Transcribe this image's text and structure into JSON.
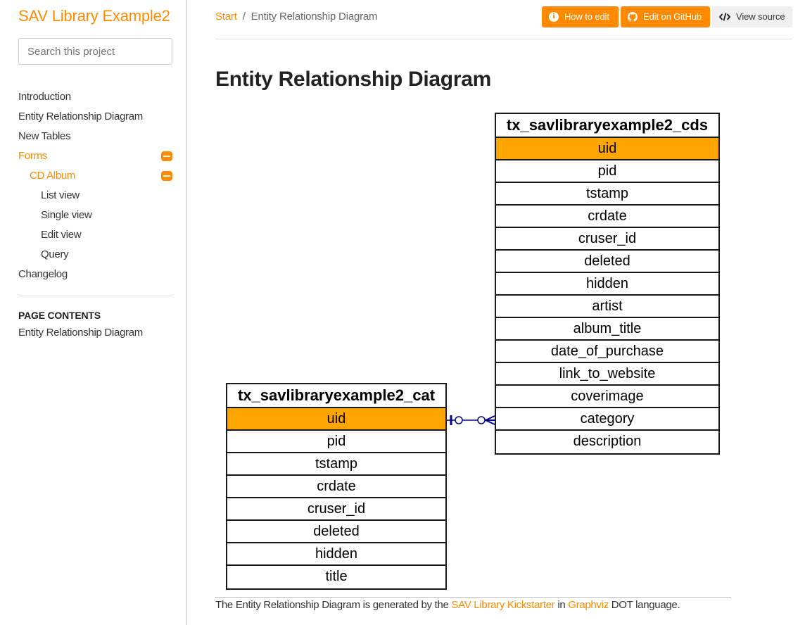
{
  "sidebar": {
    "site_title": "SAV Library Example2",
    "search_placeholder": "Search this project",
    "nav": [
      {
        "label": "Introduction",
        "level": 0,
        "active": false
      },
      {
        "label": "Entity Relationship Diagram",
        "level": 0,
        "active": false
      },
      {
        "label": "New Tables",
        "level": 0,
        "active": false
      },
      {
        "label": "Forms",
        "level": 0,
        "active": true,
        "expanded": true
      },
      {
        "label": "CD Album",
        "level": 1,
        "active": true,
        "expanded": true
      },
      {
        "label": "List view",
        "level": 2,
        "active": false
      },
      {
        "label": "Single view",
        "level": 2,
        "active": false
      },
      {
        "label": "Edit view",
        "level": 2,
        "active": false
      },
      {
        "label": "Query",
        "level": 2,
        "active": false
      },
      {
        "label": "Changelog",
        "level": 0,
        "active": false
      }
    ],
    "toc_title": "PAGE CONTENTS",
    "toc_items": [
      "Entity Relationship Diagram"
    ]
  },
  "breadcrumb": {
    "home": "Start",
    "separator": "/",
    "current": "Entity Relationship Diagram"
  },
  "toolbar": {
    "how_to_edit": "How to edit",
    "edit_on_github": "Edit on GitHub",
    "view_source": "View source"
  },
  "page": {
    "title": "Entity Relationship Diagram"
  },
  "diagram": {
    "entities": [
      {
        "name": "tx_savlibraryexample2_cds",
        "key_field": "uid",
        "fields": [
          "uid",
          "pid",
          "tstamp",
          "crdate",
          "cruser_id",
          "deleted",
          "hidden",
          "artist",
          "album_title",
          "date_of_purchase",
          "link_to_website",
          "coverimage",
          "category",
          "description"
        ]
      },
      {
        "name": "tx_savlibraryexample2_cat",
        "key_field": "uid",
        "fields": [
          "uid",
          "pid",
          "tstamp",
          "crdate",
          "cruser_id",
          "deleted",
          "hidden",
          "title"
        ]
      }
    ],
    "relation": {
      "from": "tx_savlibraryexample2_cat.uid",
      "to": "tx_savlibraryexample2_cds.category",
      "from_cardinality": "zero-or-one",
      "to_cardinality": "zero-or-many",
      "color": "#00008b"
    }
  },
  "caption": {
    "prefix": "The Entity Relationship Diagram is generated by the ",
    "link1": "SAV Library Kickstarter",
    "middle": " in ",
    "link2": "Graphviz",
    "suffix": " DOT language."
  },
  "colors": {
    "accent": "#ff8a00",
    "key_field": "#ffa500"
  }
}
